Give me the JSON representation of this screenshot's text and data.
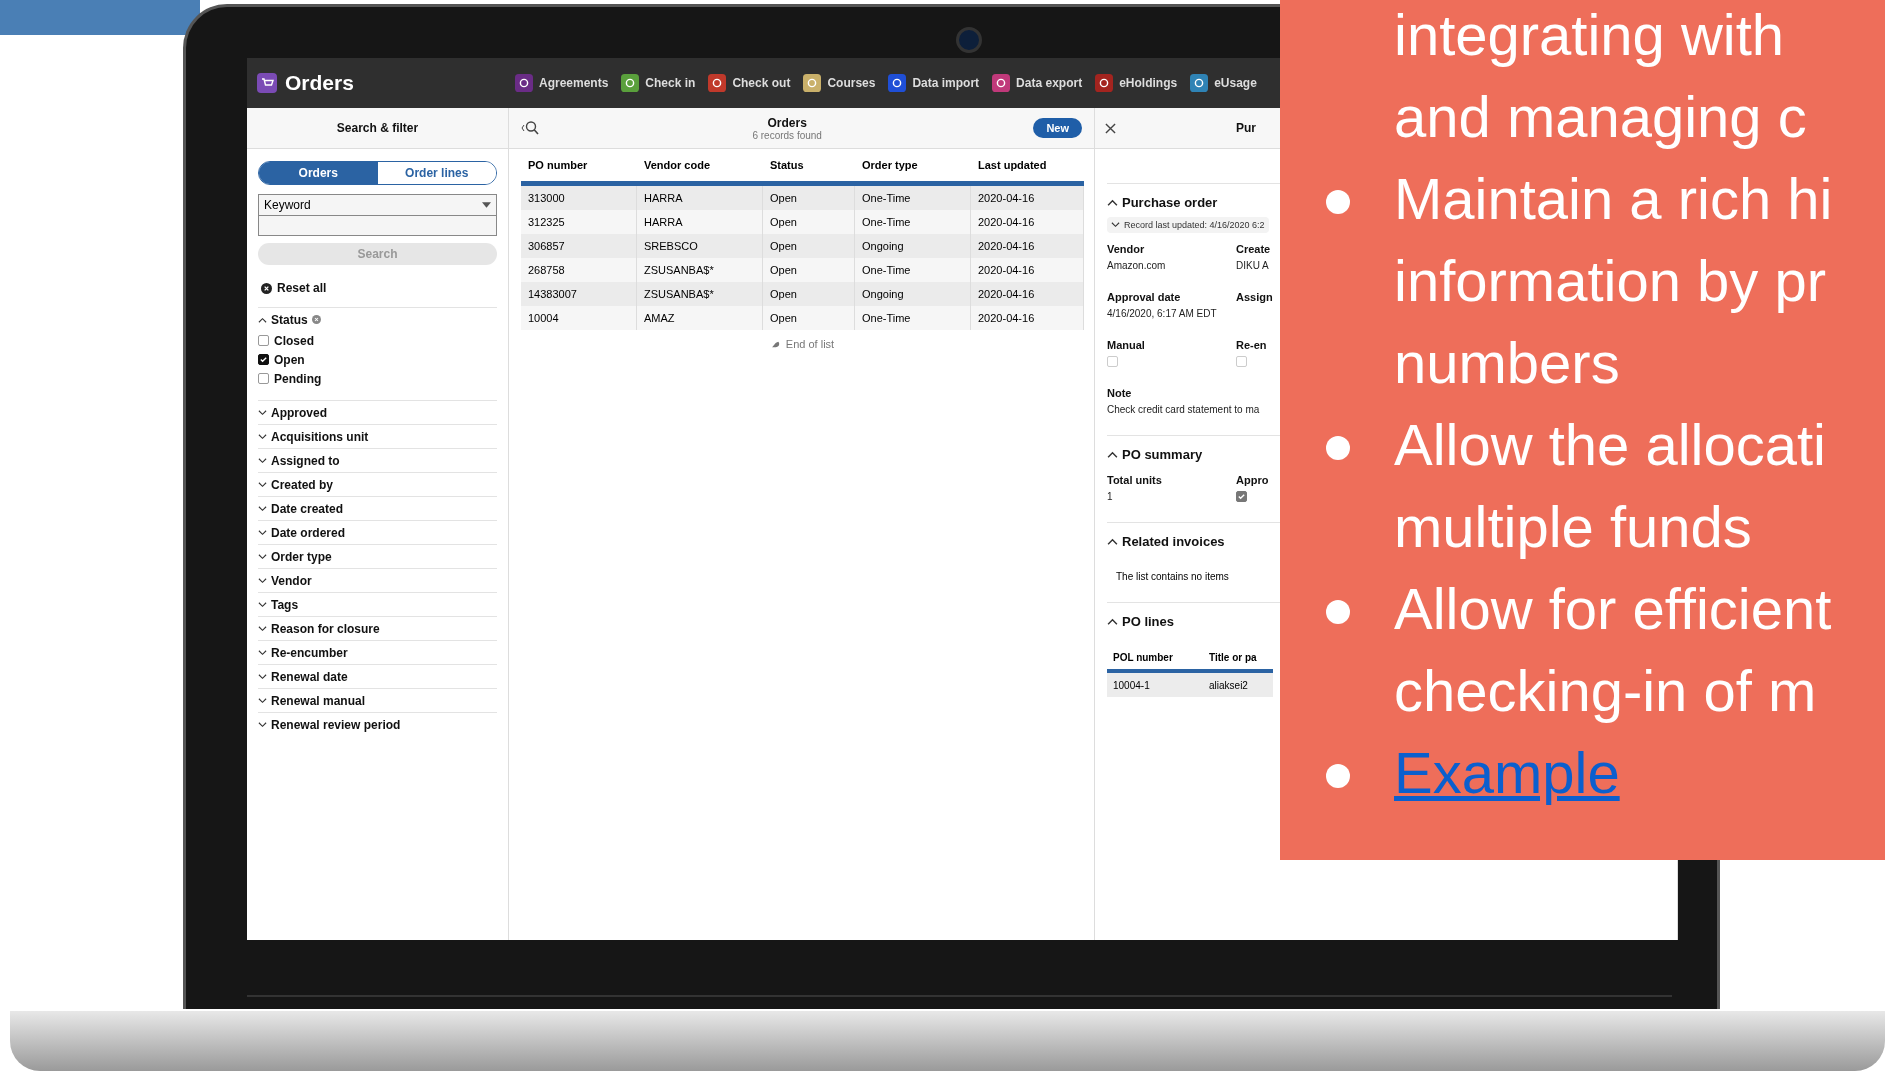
{
  "slide": {
    "lines": [
      "integrating with",
      "and managing c"
    ],
    "bullets": [
      {
        "kind": "text",
        "lines": [
          "Maintain a rich hi",
          "information by pr",
          "numbers"
        ]
      },
      {
        "kind": "text",
        "lines": [
          "Allow the allocati",
          "multiple funds"
        ]
      },
      {
        "kind": "text",
        "lines": [
          "Allow for efficient",
          "checking-in of m"
        ]
      },
      {
        "kind": "link",
        "lines": [
          "Example"
        ]
      }
    ]
  },
  "app": {
    "title": "Orders",
    "nav": [
      {
        "label": "Agreements",
        "color": "#6a2c86"
      },
      {
        "label": "Check in",
        "color": "#5aa03c"
      },
      {
        "label": "Check out",
        "color": "#c0392b"
      },
      {
        "label": "Courses",
        "color": "#c9b06a"
      },
      {
        "label": "Data import",
        "color": "#1f4fd6"
      },
      {
        "label": "Data export",
        "color": "#c0397a"
      },
      {
        "label": "eHoldings",
        "color": "#a3241f"
      },
      {
        "label": "eUsage",
        "color": "#2f83b5"
      }
    ]
  },
  "filter_pane": {
    "title": "Search & filter",
    "segments": [
      {
        "label": "Orders",
        "selected": true
      },
      {
        "label": "Order lines",
        "selected": false
      }
    ],
    "index_select": "Keyword",
    "search_button": "Search",
    "reset": "Reset all",
    "filters": [
      {
        "label": "Status",
        "expanded": true,
        "options": [
          {
            "label": "Closed",
            "checked": false
          },
          {
            "label": "Open",
            "checked": true
          },
          {
            "label": "Pending",
            "checked": false
          }
        ]
      },
      {
        "label": "Approved",
        "expanded": false
      },
      {
        "label": "Acquisitions unit",
        "expanded": false
      },
      {
        "label": "Assigned to",
        "expanded": false
      },
      {
        "label": "Created by",
        "expanded": false
      },
      {
        "label": "Date created",
        "expanded": false
      },
      {
        "label": "Date ordered",
        "expanded": false
      },
      {
        "label": "Order type",
        "expanded": false
      },
      {
        "label": "Vendor",
        "expanded": false
      },
      {
        "label": "Tags",
        "expanded": false
      },
      {
        "label": "Reason for closure",
        "expanded": false
      },
      {
        "label": "Re-encumber",
        "expanded": false
      },
      {
        "label": "Renewal date",
        "expanded": false
      },
      {
        "label": "Renewal manual",
        "expanded": false
      },
      {
        "label": "Renewal review period",
        "expanded": false
      }
    ]
  },
  "results_pane": {
    "title": "Orders",
    "subtitle": "6 records found",
    "new_button": "New",
    "columns": [
      "PO number",
      "Vendor code",
      "Status",
      "Order type",
      "Last updated"
    ],
    "rows": [
      [
        "313000",
        "HARRA",
        "Open",
        "One-Time",
        "2020-04-16"
      ],
      [
        "312325",
        "HARRA",
        "Open",
        "One-Time",
        "2020-04-16"
      ],
      [
        "306857",
        "SREBSCO",
        "Open",
        "Ongoing",
        "2020-04-16"
      ],
      [
        "268758",
        "ZSUSANBA$*",
        "Open",
        "One-Time",
        "2020-04-16"
      ],
      [
        "14383007",
        "ZSUSANBA$*",
        "Open",
        "Ongoing",
        "2020-04-16"
      ],
      [
        "10004",
        "AMAZ",
        "Open",
        "One-Time",
        "2020-04-16"
      ]
    ],
    "end_of_list": "End of list"
  },
  "detail_pane": {
    "title": "Pur",
    "sections": [
      {
        "kind": "fields",
        "title": "Purchase order",
        "expanded": true,
        "meta": "Record last updated: 4/16/2020 6:2",
        "fields": [
          {
            "kind": "text",
            "label": "Vendor",
            "value": "Amazon.com"
          },
          {
            "kind": "text",
            "label": "Create",
            "value": "DIKU A"
          },
          {
            "kind": "text",
            "label": "Approval date",
            "value": "4/16/2020, 6:17 AM EDT"
          },
          {
            "kind": "text",
            "label": "Assign"
          },
          {
            "kind": "checkbox",
            "label": "Manual",
            "checked": false
          },
          {
            "kind": "checkbox",
            "label": "Re-en",
            "checked": false
          },
          {
            "kind": "note",
            "label": "Note",
            "value": "Check credit card statement to ma"
          }
        ]
      },
      {
        "kind": "fields",
        "title": "PO summary",
        "expanded": true,
        "fields": [
          {
            "kind": "text",
            "label": "Total units",
            "value": "1"
          },
          {
            "kind": "checkbox",
            "label": "Appro",
            "checked": true
          }
        ]
      },
      {
        "kind": "empty",
        "title": "Related invoices",
        "expanded": true,
        "message": "The list contains no items"
      },
      {
        "kind": "table",
        "title": "PO lines",
        "expanded": true,
        "columns": [
          "POL number",
          "Title or pa"
        ],
        "rows": [
          [
            "10004-1",
            "aliaksei2"
          ]
        ]
      }
    ]
  }
}
